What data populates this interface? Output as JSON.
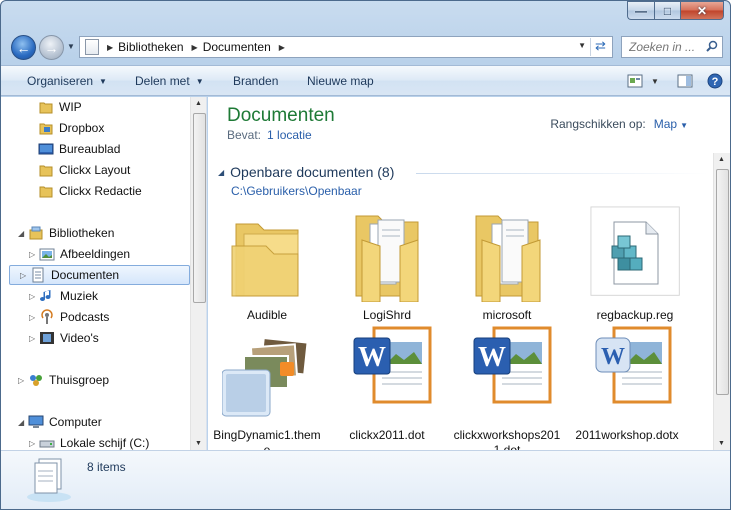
{
  "nav": {
    "breadcrumbs": [
      "Bibliotheken",
      "Documenten"
    ],
    "search_placeholder": "Zoeken in ..."
  },
  "toolbar": {
    "organize": "Organiseren",
    "share": "Delen met",
    "burn": "Branden",
    "new_folder": "Nieuwe map"
  },
  "sidebar": {
    "favorites": [
      "WIP",
      "Dropbox",
      "Bureaublad",
      "Clickx Layout",
      "Clickx Redactie"
    ],
    "libraries_label": "Bibliotheken",
    "libraries": [
      "Afbeeldingen",
      "Documenten",
      "Muziek",
      "Podcasts",
      "Video's"
    ],
    "homegroup": "Thuisgroep",
    "computer": "Computer",
    "local_disk": "Lokale schijf (C:)"
  },
  "library": {
    "title": "Documenten",
    "includes_label": "Bevat:",
    "includes_link": "1 locatie",
    "arrange_label": "Rangschikken op:",
    "arrange_value": "Map"
  },
  "group": {
    "title": "Openbare documenten (8)",
    "path": "C:\\Gebruikers\\Openbaar"
  },
  "files": [
    {
      "name": "Audible",
      "icon": "folder-empty-icon"
    },
    {
      "name": "LogiShrd",
      "icon": "folder-icon"
    },
    {
      "name": "microsoft",
      "icon": "folder-icon"
    },
    {
      "name": "regbackup.reg",
      "icon": "registry-file-icon"
    },
    {
      "name": "BingDynamic1.theme",
      "icon": "theme-file-icon"
    },
    {
      "name": "clickx2011.dot",
      "icon": "word-template-icon"
    },
    {
      "name": "clickxworkshops2011.dot",
      "icon": "word-template-icon"
    },
    {
      "name": "2011workshop.dotx",
      "icon": "word-template-icon"
    }
  ],
  "details": {
    "item_count": "8 items"
  },
  "colors": {
    "title_green": "#1e7a36",
    "link_blue": "#2a5faa",
    "header_navy": "#1e395b"
  }
}
